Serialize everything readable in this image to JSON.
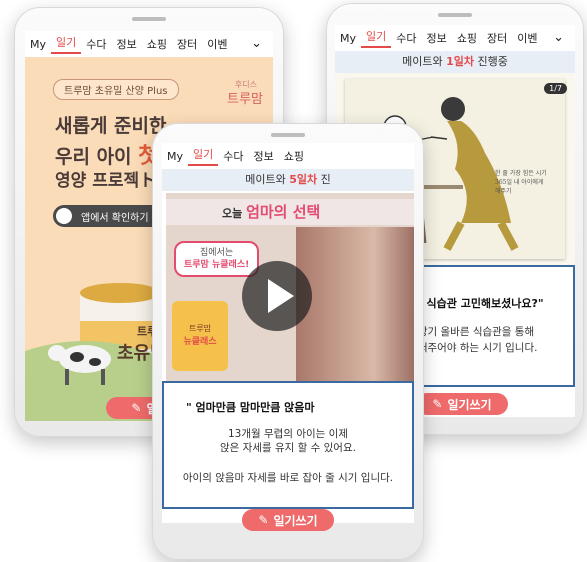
{
  "nav": {
    "items": [
      "My",
      "일기",
      "수다",
      "정보",
      "쇼핑",
      "장터",
      "이벤"
    ],
    "active": "일기"
  },
  "left": {
    "badge": "트루맘 초유밀 산양 Plus",
    "logo_small": "후디스",
    "logo": "트루맘",
    "headline1": "새롭게 준비한",
    "headline2_a": "우리 아이 ",
    "headline2_b": "첫",
    "headline3": "영양 프로젝ト",
    "cta": "앱에서 확인하기",
    "can_brand": "트루",
    "can_name": "초유밀",
    "write": "일기"
  },
  "center": {
    "banner_pre": "메이트와 ",
    "banner_hl": "5일차",
    "banner_post": " 진",
    "video_title_a": "오늘 ",
    "video_title_b": "엄마의 선택",
    "sticker1": "집에서는",
    "sticker2": "트루맘 뉴클래스!",
    "can_brand": "트루맘",
    "can_name": "뉴클래스",
    "quote": "\" 엄마만큼 맘마만큼 앉음마",
    "text1": "13개월 무렵의 아이는 이제",
    "text2": "앉은 자세를 유지 할 수 있어요.",
    "text3": "아이의 앉음마 자세를 바로 잡아 줄 시기 입니다.",
    "write": "일기쓰기"
  },
  "right": {
    "banner_pre": "메이트와 ",
    "banner_hl": "1일차",
    "banner_post": " 진행중",
    "counter": "1/7",
    "sketch_text1": "한 줄 가장 힘든 시기",
    "sketch_text2": "365일 내 아이에게",
    "sketch_text3": "해주기",
    "quote": "\"우리아이의 식습관 고민해보셨나요?\"",
    "text1": "아이의 성장기 올바른 식습관을 통해",
    "text2": "더 신경을 써주어야 하는 시기 입니다.",
    "write": "일기쓰기"
  },
  "colors": {
    "accent": "#e34b4b",
    "peach": "#fbdcb8",
    "pink_btn": "#ef6b6b",
    "banner": "#e7eef6",
    "sketch_bg": "#f4f1e2"
  }
}
